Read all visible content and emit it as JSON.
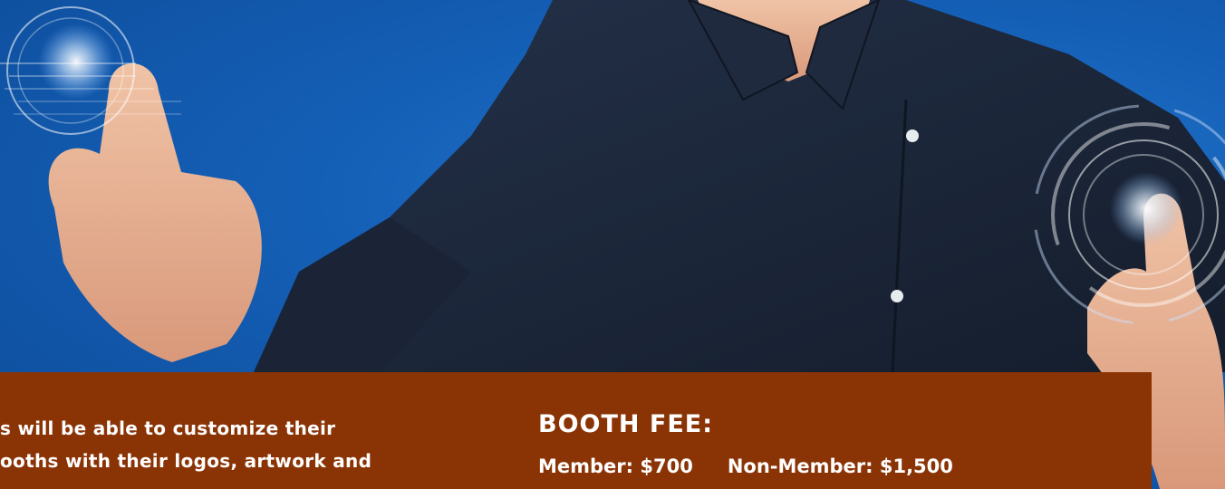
{
  "panel": {
    "description_lines": [
      "s will be able to customize their",
      "ooths with their logos, artwork and"
    ],
    "fee_title": "BOOTH FEE:",
    "member_fee": "Member: $700",
    "non_member_fee": "Non-Member: $1,500"
  },
  "colors": {
    "background_blue": "#1560b8",
    "panel_orange": "#8a3406",
    "shirt_navy": "#1b2638",
    "skin": "#e9b79a"
  },
  "icons": [
    "touch-ring-icon-left",
    "touch-ring-icon-right"
  ]
}
